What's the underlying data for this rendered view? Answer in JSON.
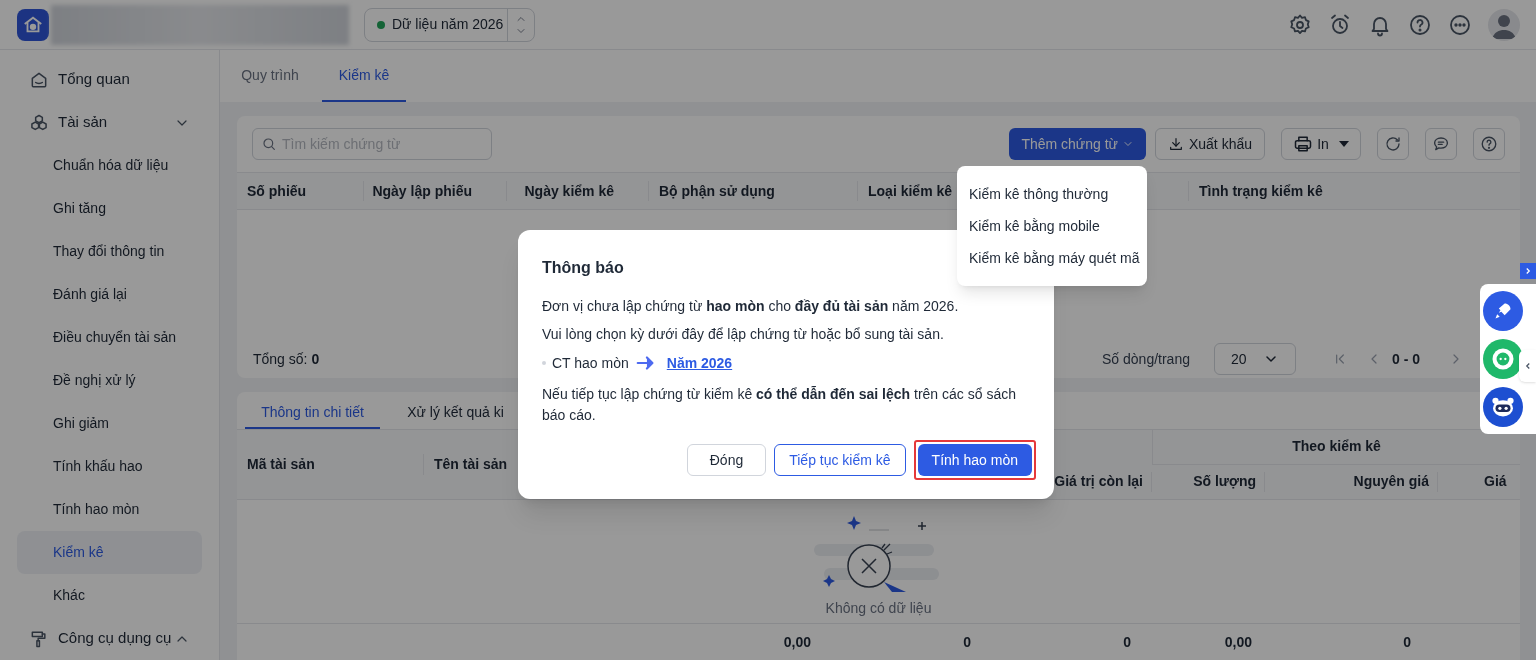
{
  "header": {
    "year_selector": {
      "label": "Dữ liệu năm 2026"
    }
  },
  "sidebar": {
    "items": [
      {
        "label": "Tổng quan",
        "kind": "link"
      },
      {
        "label": "Tài sản",
        "kind": "group",
        "expanded": true,
        "children": [
          {
            "label": "Chuẩn hóa dữ liệu",
            "selected": false
          },
          {
            "label": "Ghi tăng",
            "selected": false
          },
          {
            "label": "Thay đổi thông tin",
            "selected": false
          },
          {
            "label": "Đánh giá lại",
            "selected": false
          },
          {
            "label": "Điều chuyển tài sản",
            "selected": false
          },
          {
            "label": "Đề nghị xử lý",
            "selected": false
          },
          {
            "label": "Ghi giảm",
            "selected": false
          },
          {
            "label": "Tính khấu hao",
            "selected": false
          },
          {
            "label": "Tính hao mòn",
            "selected": false
          },
          {
            "label": "Kiểm kê",
            "selected": true
          },
          {
            "label": "Khác",
            "selected": false
          }
        ]
      },
      {
        "label": "Công cụ dụng cụ",
        "kind": "group",
        "expanded": false
      }
    ]
  },
  "tabs": [
    {
      "label": "Quy trình",
      "selected": false
    },
    {
      "label": "Kiểm kê",
      "selected": true
    }
  ],
  "toolbar": {
    "search": {
      "placeholder": "Tìm kiếm chứng từ"
    },
    "buttons": [
      {
        "label": "Thêm chứng từ",
        "kind": "primary"
      },
      {
        "label": "Xuất khẩu",
        "kind": "export"
      },
      {
        "label": "In",
        "kind": "print"
      }
    ]
  },
  "add_menu": {
    "items": [
      "Kiểm kê thông thường",
      "Kiểm kê bằng mobile",
      "Kiểm kê bằng máy quét mã"
    ]
  },
  "vouchers_table": {
    "columns": [
      "Số phiếu",
      "Ngày lập phiếu",
      "Ngày kiểm kê",
      "Bộ phận sử dụng",
      "Loại kiểm kê",
      "",
      "Tình trạng kiểm kê"
    ],
    "total": "Tổng số: **0**",
    "rows_per_page_label": "Số dòng/trang",
    "page_size": "20",
    "range": "0 - 0"
  },
  "detail_tabs": [
    {
      "label": "Thông tin chi tiết",
      "selected": true
    },
    {
      "label": "Xử lý kết quả ki",
      "selected": false
    }
  ],
  "detail_table": {
    "left_columns": [
      "Mã tài sản",
      "Tên tài sản"
    ],
    "group_header": "Theo kiểm kê",
    "right_columns": [
      "Giá trị còn lại",
      "Số lượng",
      "Nguyên giá",
      "Giá"
    ],
    "empty_text": "Không có dữ liệu",
    "totals": [
      "0,00",
      "0",
      "0",
      "0,00",
      "0"
    ]
  },
  "dialog": {
    "title": "Thông báo",
    "message": "Đơn vị chưa lập chứng từ **hao mòn** cho **đầy đủ tài sản** năm 2026.",
    "instruction": "Vui lòng chọn kỳ dưới đây để lập chứng từ hoặc bổ sung tài sản.",
    "period_label": "CT hao mòn",
    "period_link": "Năm 2026",
    "warning": "Nếu tiếp tục lập chứng từ kiểm kê **có thể dẫn đến sai lệch** trên các sổ sách báo cáo.",
    "buttons": [
      {
        "label": "Đóng",
        "kind": "default",
        "highlighted": false
      },
      {
        "label": "Tiếp tục kiểm kê",
        "kind": "outline",
        "highlighted": false
      },
      {
        "label": "Tính hao mòn",
        "kind": "primary",
        "highlighted": true
      }
    ]
  }
}
